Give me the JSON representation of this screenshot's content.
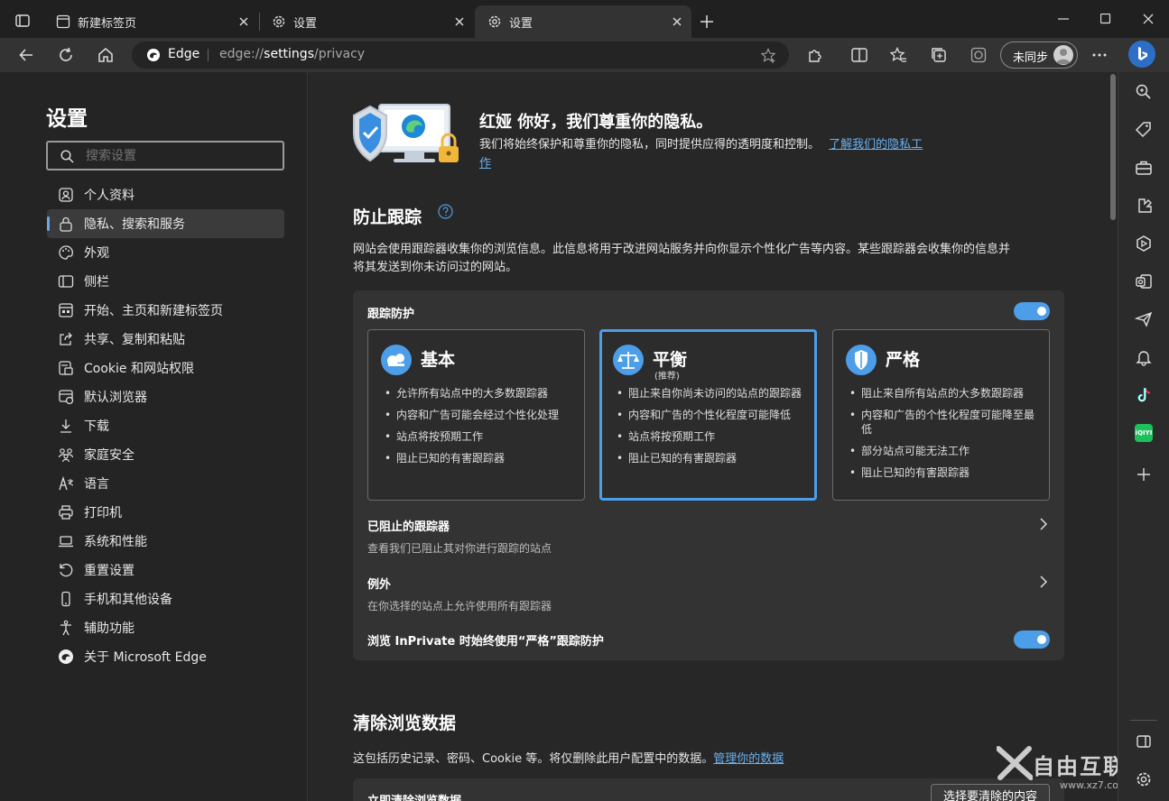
{
  "tabs": [
    {
      "label": "新建标签页"
    },
    {
      "label": "设置"
    },
    {
      "label": "设置"
    }
  ],
  "address": {
    "brand": "Edge",
    "url_prefix": "edge://",
    "url_main": "settings",
    "url_suffix": "/privacy"
  },
  "profile": {
    "label": "未同步"
  },
  "settings_title": "设置",
  "search": {
    "placeholder": "搜索设置"
  },
  "nav": [
    "个人资料",
    "隐私、搜索和服务",
    "外观",
    "侧栏",
    "开始、主页和新建标签页",
    "共享、复制和粘贴",
    "Cookie 和网站权限",
    "默认浏览器",
    "下载",
    "家庭安全",
    "语言",
    "打印机",
    "系统和性能",
    "重置设置",
    "手机和其他设备",
    "辅助功能",
    "关于 Microsoft Edge"
  ],
  "header": {
    "title": "红娅 你好，我们尊重你的隐私。",
    "desc": "我们将始终保护和尊重你的隐私，同时提供应得的透明度和控制。",
    "link_line1": "了解我们的隐私工",
    "link_line2": "作"
  },
  "tracking": {
    "title": "防止跟踪",
    "desc_line1": "网站会使用跟踪器收集你的浏览信息。此信息将用于改进网站服务并向你显示个性化广告等内容。某些跟踪器会收集你的信息并",
    "desc_line2": "将其发送到你未访问过的网站。",
    "protection_label": "跟踪防护",
    "options": [
      {
        "title": "基本",
        "sub": "",
        "items": [
          "允许所有站点中的大多数跟踪器",
          "内容和广告可能会经过个性化处理",
          "站点将按预期工作",
          "阻止已知的有害跟踪器"
        ]
      },
      {
        "title": "平衡",
        "sub": "(推荐)",
        "items": [
          "阻止来自你尚未访问的站点的跟踪器",
          "内容和广告的个性化程度可能降低",
          "站点将按预期工作",
          "阻止已知的有害跟踪器"
        ]
      },
      {
        "title": "严格",
        "sub": "",
        "items": [
          "阻止来自所有站点的大多数跟踪器",
          "内容和广告的个性化程度可能降至最低",
          "部分站点可能无法工作",
          "阻止已知的有害跟踪器"
        ]
      }
    ],
    "blocked": {
      "title": "已阻止的跟踪器",
      "desc": "查看我们已阻止其对你进行跟踪的站点"
    },
    "exceptions": {
      "title": "例外",
      "desc": "在你选择的站点上允许使用所有跟踪器"
    },
    "inprivate": "浏览 InPrivate 时始终使用“严格”跟踪防护"
  },
  "clear": {
    "title": "清除浏览数据",
    "desc": "这包括历史记录、密码、Cookie 等。将仅删除此用户配置中的数据。",
    "link": "管理你的数据",
    "row_label": "立即清除浏览数据",
    "row_button": "选择要清除的内容"
  },
  "watermark": {
    "text": "自由互联",
    "url": "www.xz7.com"
  },
  "colors": {
    "accent": "#4c9ee8",
    "link": "#69b1ef",
    "background": "#272727",
    "card": "#333333"
  }
}
